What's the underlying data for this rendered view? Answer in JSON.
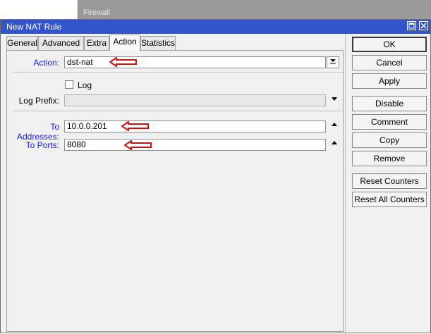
{
  "background_window": {
    "title": "Firewall"
  },
  "dialog": {
    "title": "New NAT Rule",
    "tabs": [
      {
        "label": "General"
      },
      {
        "label": "Advanced"
      },
      {
        "label": "Extra"
      },
      {
        "label": "Action",
        "active": true
      },
      {
        "label": "Statistics"
      }
    ],
    "action": {
      "label": "Action:",
      "value": "dst-nat"
    },
    "log": {
      "label": "Log",
      "checked": false
    },
    "log_prefix": {
      "label": "Log Prefix:",
      "value": ""
    },
    "to_addresses": {
      "label": "To Addresses:",
      "value": "10.0.0.201"
    },
    "to_ports": {
      "label": "To Ports:",
      "value": "8080"
    },
    "buttons": [
      {
        "label": "OK"
      },
      {
        "label": "Cancel"
      },
      {
        "label": "Apply"
      },
      {
        "label": "Disable"
      },
      {
        "label": "Comment"
      },
      {
        "label": "Copy"
      },
      {
        "label": "Remove"
      },
      {
        "label": "Reset Counters"
      },
      {
        "label": "Reset All Counters"
      }
    ]
  },
  "icons": {
    "restore": "restore-icon",
    "close": "close-icon",
    "dropdown": "dropdown-arrow-icon",
    "annotation": "red-arrow-annotation-icon"
  },
  "colors": {
    "titlebar": "#3355c8",
    "label_highlight": "#1a1ad4",
    "annotation": "#cc1111"
  }
}
